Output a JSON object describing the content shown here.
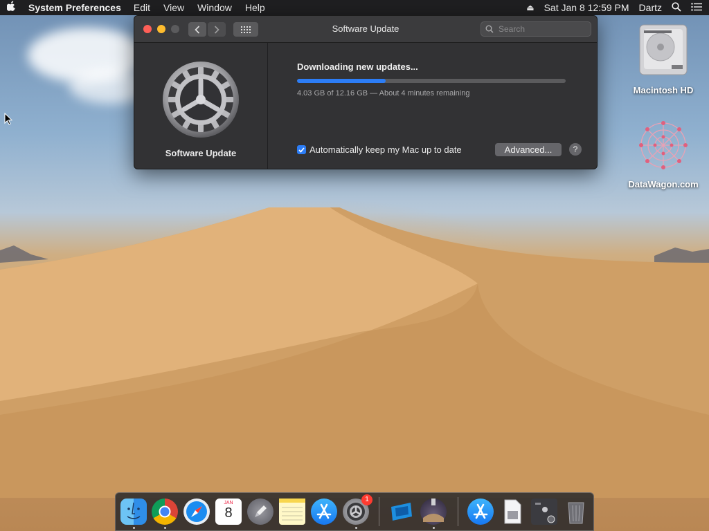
{
  "menubar": {
    "app_name": "System Preferences",
    "menus": [
      "Edit",
      "View",
      "Window",
      "Help"
    ],
    "datetime": "Sat Jan 8  12:59 PM",
    "user": "Dartz"
  },
  "window": {
    "title": "Software Update",
    "search_placeholder": "Search",
    "sidebar_label": "Software Update",
    "status": "Downloading new updates...",
    "progress_fraction": 0.33,
    "progress_detail": "4.03 GB of 12.16 GB — About 4 minutes remaining",
    "auto_update_label": "Automatically keep my Mac up to date",
    "auto_update_checked": true,
    "advanced_label": "Advanced...",
    "help_label": "?"
  },
  "desktop": {
    "icons": [
      {
        "label": "Macintosh HD"
      },
      {
        "label": "DataWagon.com"
      }
    ]
  },
  "dock": {
    "apps": [
      "finder",
      "chrome",
      "safari",
      "calendar",
      "launchpad",
      "notes",
      "app-store",
      "system-preferences",
      "remote-desktop",
      "mojave-installer",
      "app-store-2",
      "preview",
      "screenshot-folder",
      "trash"
    ],
    "system_preferences_badge": "1",
    "calendar_month": "JAN",
    "calendar_day": "8"
  },
  "colors": {
    "accent": "#2c7df6",
    "close": "#fe5f57",
    "minimize": "#febc2e",
    "badge": "#ff3b30"
  }
}
